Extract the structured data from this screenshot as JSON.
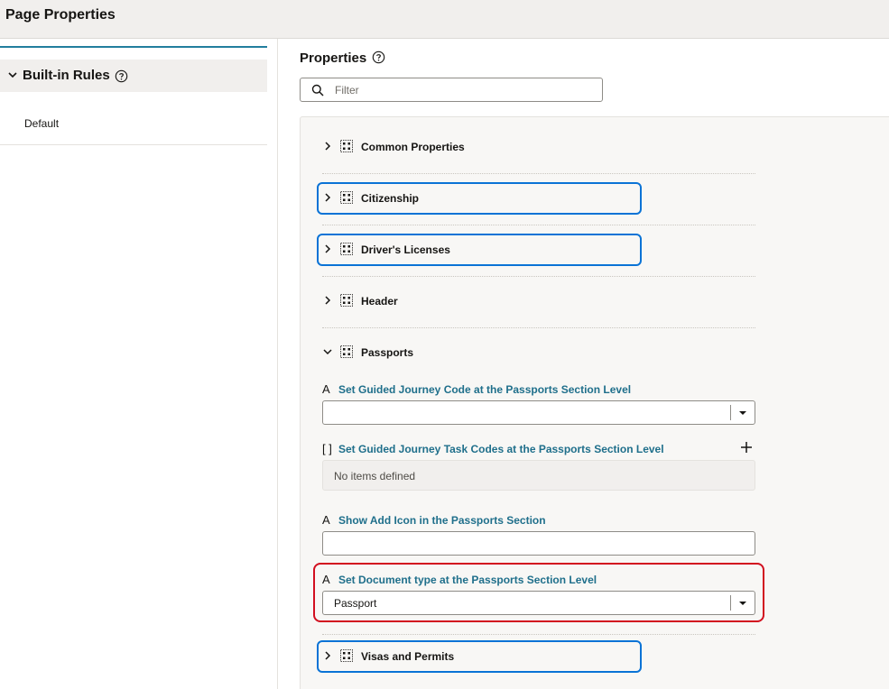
{
  "header": {
    "title": "Page Properties"
  },
  "left": {
    "rules_label": "Built-in Rules",
    "items": [
      {
        "label": "Default"
      }
    ]
  },
  "props": {
    "title": "Properties",
    "filter_placeholder": "Filter",
    "sections": [
      {
        "name": "Common Properties",
        "expanded": false
      },
      {
        "name": "Citizenship",
        "expanded": false
      },
      {
        "name": "Driver's Licenses",
        "expanded": false
      },
      {
        "name": "Header",
        "expanded": false
      },
      {
        "name": "Passports",
        "expanded": true
      },
      {
        "name": "Visas and Permits",
        "expanded": false
      }
    ],
    "fields": [
      {
        "icon": "text-icon",
        "label": "Set Guided Journey Code at the Passports Section Level",
        "value": ""
      },
      {
        "icon": "array-icon",
        "label": "Set Guided Journey Task Codes at the Passports Section Level",
        "empty_text": "No items defined"
      },
      {
        "icon": "text-icon",
        "label": "Show Add Icon in the Passports Section",
        "value": ""
      },
      {
        "icon": "text-icon",
        "label": "Set Document type at the Passports Section Level",
        "value": "Passport"
      }
    ]
  },
  "colors": {
    "highlight_blue": "#0a73d6",
    "highlight_red": "#d20f1f",
    "link_teal": "#1f6f8b",
    "accent": "#227e9e"
  }
}
